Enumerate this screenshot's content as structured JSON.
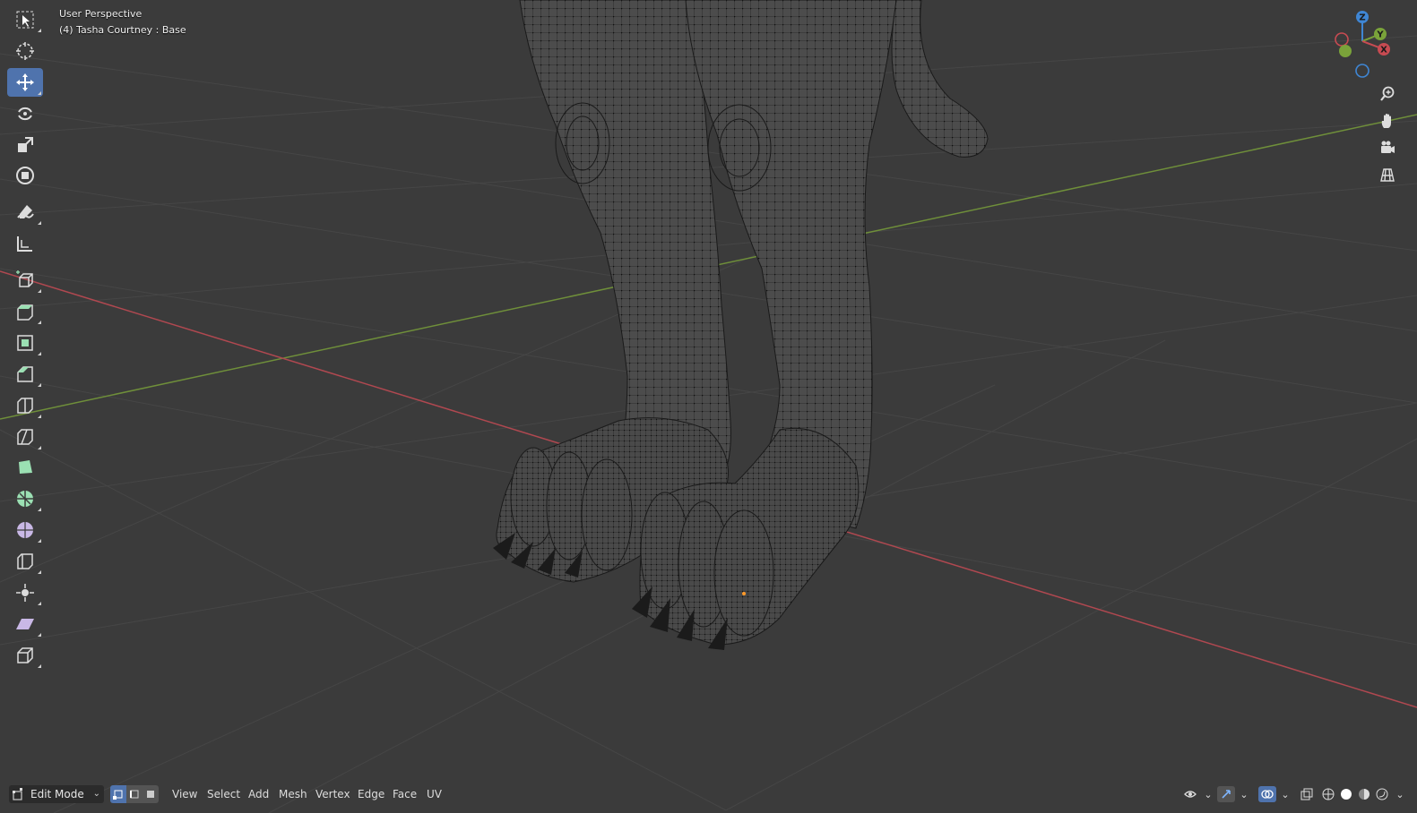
{
  "viewport": {
    "perspective_label": "User Perspective",
    "object_label": "(4) Tasha Courtney : Base"
  },
  "toolbar": {
    "tools": [
      {
        "name": "select-box",
        "active": false
      },
      {
        "name": "cursor",
        "active": false
      },
      {
        "name": "move",
        "active": true
      },
      {
        "name": "rotate",
        "active": false
      },
      {
        "name": "scale",
        "active": false
      },
      {
        "name": "transform",
        "active": false
      },
      {
        "name": "annotate",
        "active": false
      },
      {
        "name": "measure",
        "active": false
      },
      {
        "name": "add-cube",
        "active": false
      },
      {
        "name": "extrude-region",
        "active": false
      },
      {
        "name": "inset-faces",
        "active": false
      },
      {
        "name": "bevel",
        "active": false
      },
      {
        "name": "loop-cut",
        "active": false
      },
      {
        "name": "knife",
        "active": false
      },
      {
        "name": "poly-build",
        "active": false
      },
      {
        "name": "spin",
        "active": false
      },
      {
        "name": "smooth",
        "active": false
      },
      {
        "name": "edge-slide",
        "active": false
      },
      {
        "name": "shrink-fatten",
        "active": false
      },
      {
        "name": "shear",
        "active": false
      },
      {
        "name": "rip-region",
        "active": false
      }
    ]
  },
  "gizmo": {
    "z": "Z",
    "y": "Y",
    "x": "X"
  },
  "header": {
    "mode": "Edit Mode",
    "menus": [
      "View",
      "Select",
      "Add",
      "Mesh",
      "Vertex",
      "Edge",
      "Face",
      "UV"
    ]
  },
  "colors": {
    "background": "#3b3b3b",
    "accent": "#4f73ad",
    "x_axis": "#c84b52",
    "y_axis": "#7aa33a",
    "z_axis": "#3f86d4"
  }
}
